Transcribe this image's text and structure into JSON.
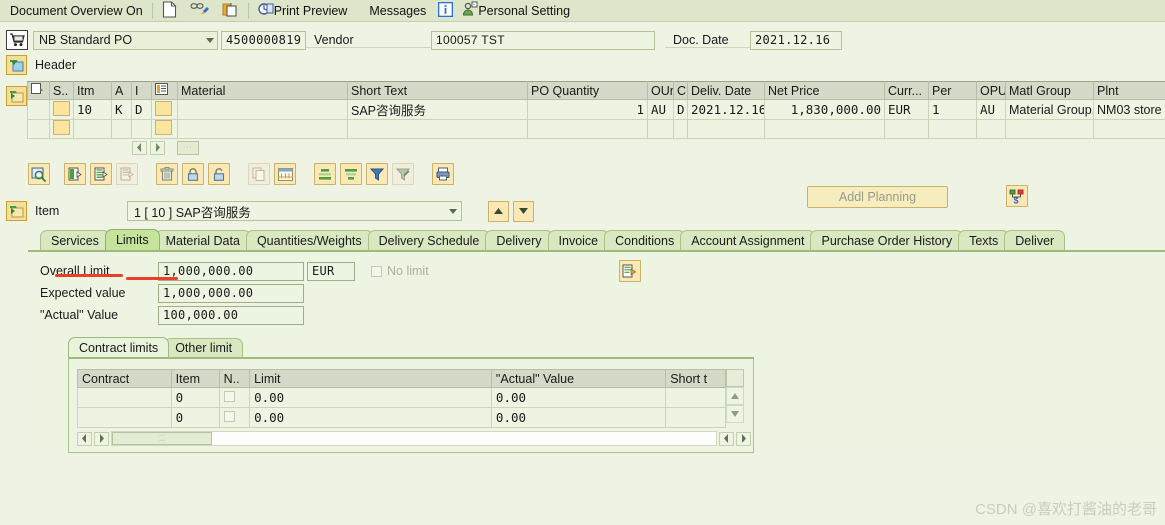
{
  "topbar": {
    "document_overview": "Document Overview On",
    "print_preview": "Print Preview",
    "messages": "Messages",
    "personal_setting": "Personal Setting",
    "icons": [
      "document-icon",
      "display-change-icon",
      "hold-icon",
      "print-preview-icon",
      "info-icon",
      "personal-setting-icon"
    ]
  },
  "doc_header": {
    "cart_icon": "shopping-cart-icon",
    "po_type": "NB Standard PO",
    "po_number": "4500000819",
    "vendor_label": "Vendor",
    "vendor_value": "100057 TST",
    "doc_date_label": "Doc. Date",
    "doc_date_value": "2021.12.16",
    "header_label": "Header"
  },
  "items_grid": {
    "columns": [
      "",
      "S..",
      "Itm",
      "A",
      "I",
      "",
      "Material",
      "Short Text",
      "PO Quantity",
      "OUn",
      "C",
      "Deliv. Date",
      "Net Price",
      "Curr...",
      "Per",
      "OPU",
      "Matl Group",
      "Plnt"
    ],
    "rows": [
      {
        "sel": "",
        "status": "",
        "itm": "10",
        "a": "K",
        "i": "D",
        "icon": "",
        "material": "",
        "short_text": "SAP咨询服务",
        "po_quantity": "1",
        "oun": "AU",
        "c": "D",
        "deliv_date": "2021.12.16",
        "net_price": "1,830,000.00",
        "curr": "EUR",
        "per": "1",
        "opu": "AU",
        "matl_group": "Material Group..",
        "plnt": "NM03 store"
      },
      {
        "sel": "",
        "status": "",
        "itm": "",
        "a": "",
        "i": "",
        "icon": "",
        "material": "",
        "short_text": "",
        "po_quantity": "",
        "oun": "",
        "c": "",
        "deliv_date": "",
        "net_price": "",
        "curr": "",
        "per": "",
        "opu": "",
        "matl_group": "",
        "plnt": ""
      }
    ]
  },
  "icon_toolbar": {
    "buttons": [
      "detail-magnifier-icon",
      "insert-row-icon",
      "duplicate-row-icon",
      "copy-row-disabled-icon",
      "delete-row-icon",
      "lock-icon",
      "unlock-icon",
      "copy-icon-disabled",
      "table-icon",
      "sort-ascending-icon",
      "sort-descending-icon",
      "filter-icon",
      "filter-off-icon",
      "print-icon"
    ],
    "addl_planning_label": "Addl Planning",
    "right_icon": "structure-value-icon"
  },
  "item_selector": {
    "folder_icon": "expand-folder-icon",
    "label": "Item",
    "value": "1 [ 10 ] SAP咨询服务",
    "up_icon": "arrow-up-icon",
    "down_icon": "arrow-down-icon"
  },
  "tabs": [
    {
      "label": "Services",
      "active": false
    },
    {
      "label": "Limits",
      "active": true
    },
    {
      "label": "Material Data",
      "active": false
    },
    {
      "label": "Quantities/Weights",
      "active": false
    },
    {
      "label": "Delivery Schedule",
      "active": false
    },
    {
      "label": "Delivery",
      "active": false
    },
    {
      "label": "Invoice",
      "active": false
    },
    {
      "label": "Conditions",
      "active": false
    },
    {
      "label": "Account Assignment",
      "active": false
    },
    {
      "label": "Purchase Order History",
      "active": false
    },
    {
      "label": "Texts",
      "active": false
    },
    {
      "label": "Deliver",
      "active": false
    }
  ],
  "limits_form": {
    "overall_limit_label": "Overall Limit",
    "overall_limit_value": "1,000,000.00",
    "currency_value": "EUR",
    "no_limit_label": "No limit",
    "no_limit_checked": false,
    "expected_value_label": "Expected value",
    "expected_value": "1,000,000.00",
    "actual_value_label": "\"Actual\" Value",
    "actual_value": "100,000.00",
    "detail_icon": "detail-list-icon"
  },
  "inner_tabs": [
    {
      "label": "Contract limits",
      "active": true
    },
    {
      "label": "Other limit",
      "active": false
    }
  ],
  "contract_table": {
    "columns": [
      "Contract",
      "Item",
      "N..",
      "Limit",
      "\"Actual\" Value",
      "Short t"
    ],
    "rows": [
      {
        "contract": "",
        "item": "0",
        "n": false,
        "limit": "0.00",
        "actual_value": "0.00",
        "short_text": ""
      },
      {
        "contract": "",
        "item": "0",
        "n": false,
        "limit": "0.00",
        "actual_value": "0.00",
        "short_text": ""
      }
    ]
  },
  "watermark": "CSDN @喜欢打酱油的老哥",
  "colors": {
    "background": "#eef3e3",
    "field_bg": "#eef4e2",
    "tab_active": "#c5e39a",
    "tab_inactive": "#d9e8c0",
    "annotation_red": "#e8402a"
  }
}
